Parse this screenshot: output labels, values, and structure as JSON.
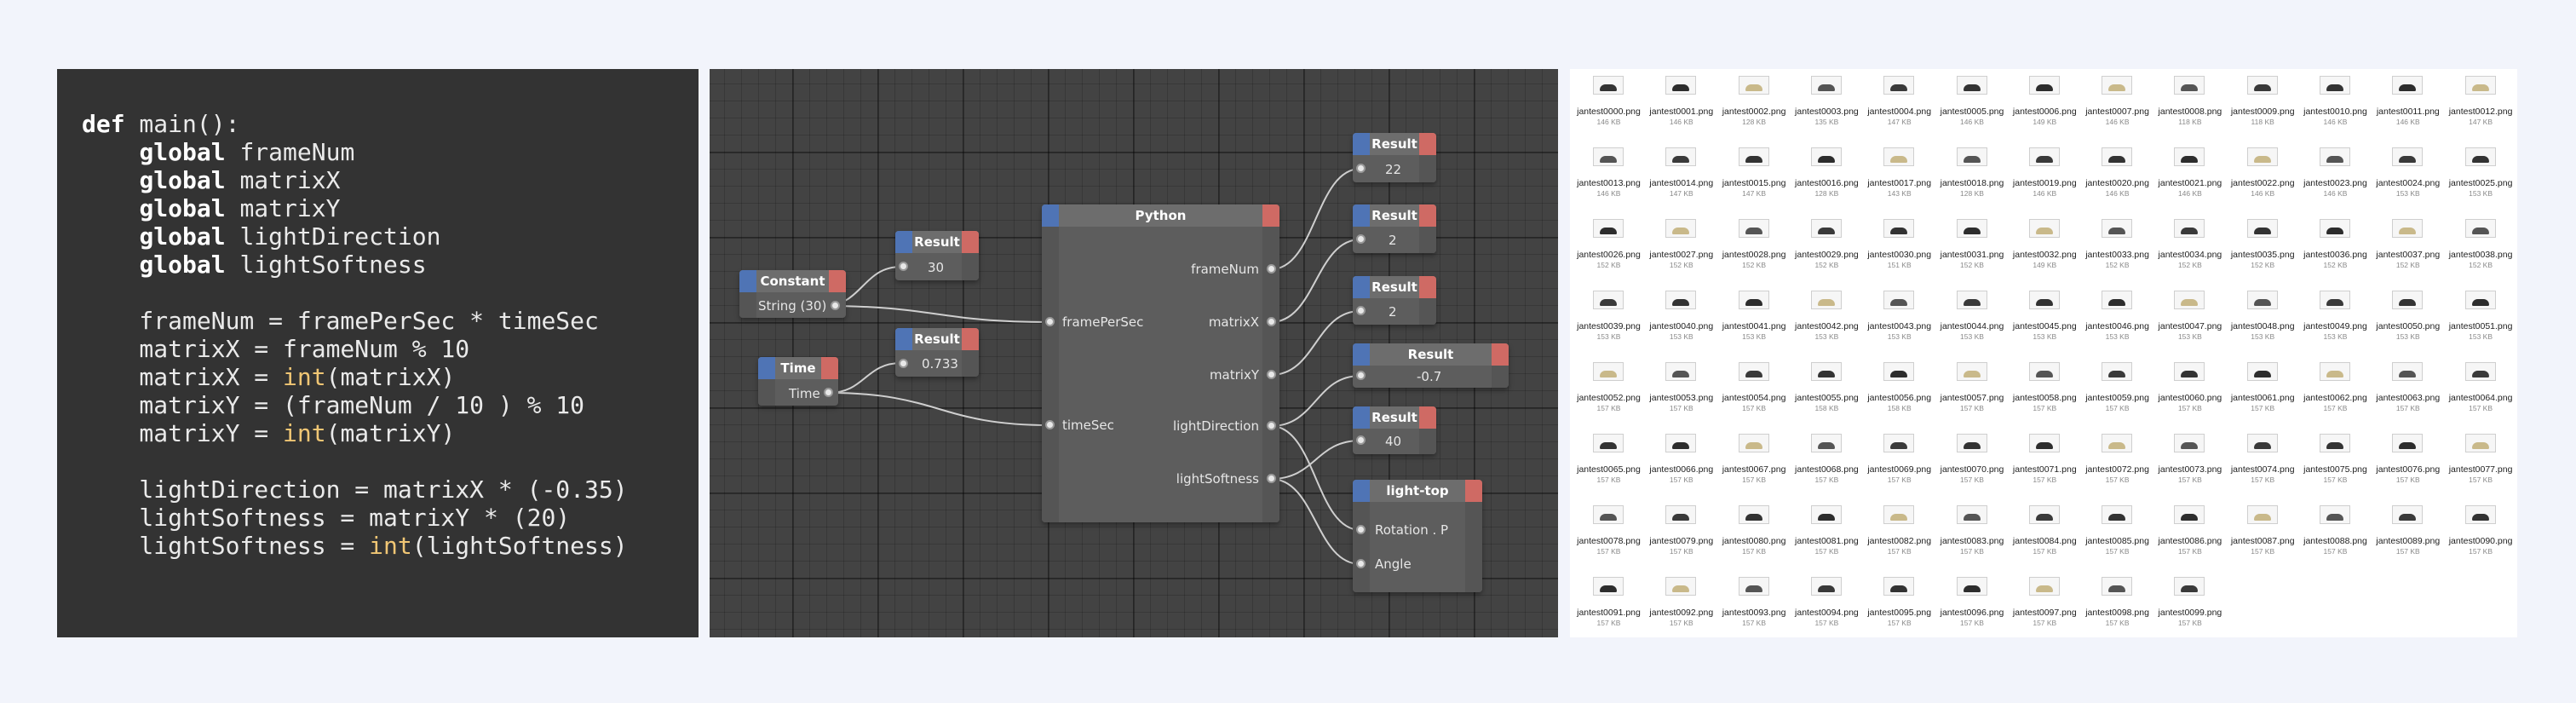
{
  "code": {
    "lines": [
      [
        {
          "t": "def",
          "c": "kw"
        },
        {
          "t": " main():",
          "c": ""
        }
      ],
      [
        {
          "t": "    ",
          "c": ""
        },
        {
          "t": "global",
          "c": "kw"
        },
        {
          "t": " frameNum",
          "c": ""
        }
      ],
      [
        {
          "t": "    ",
          "c": ""
        },
        {
          "t": "global",
          "c": "kw"
        },
        {
          "t": " matrixX",
          "c": ""
        }
      ],
      [
        {
          "t": "    ",
          "c": ""
        },
        {
          "t": "global",
          "c": "kw"
        },
        {
          "t": " matrixY",
          "c": ""
        }
      ],
      [
        {
          "t": "    ",
          "c": ""
        },
        {
          "t": "global",
          "c": "kw"
        },
        {
          "t": " lightDirection",
          "c": ""
        }
      ],
      [
        {
          "t": "    ",
          "c": ""
        },
        {
          "t": "global",
          "c": "kw"
        },
        {
          "t": " lightSoftness",
          "c": ""
        }
      ],
      [],
      [
        {
          "t": "    frameNum = framePerSec * timeSec",
          "c": ""
        }
      ],
      [
        {
          "t": "    matrixX = frameNum % 10",
          "c": ""
        }
      ],
      [
        {
          "t": "    matrixX = ",
          "c": ""
        },
        {
          "t": "int",
          "c": "fn"
        },
        {
          "t": "(matrixX)",
          "c": ""
        }
      ],
      [
        {
          "t": "    matrixY = (frameNum / 10 ) % 10",
          "c": ""
        }
      ],
      [
        {
          "t": "    matrixY = ",
          "c": ""
        },
        {
          "t": "int",
          "c": "fn"
        },
        {
          "t": "(matrixY)",
          "c": ""
        }
      ],
      [],
      [
        {
          "t": "    lightDirection = matrixX * (-0.35)",
          "c": ""
        }
      ],
      [
        {
          "t": "    lightSoftness = matrixY * (20)",
          "c": ""
        }
      ],
      [
        {
          "t": "    lightSoftness = ",
          "c": ""
        },
        {
          "t": "int",
          "c": "fn"
        },
        {
          "t": "(lightSoftness)",
          "c": ""
        }
      ]
    ]
  },
  "nodes": {
    "constant": {
      "title": "Constant",
      "value": "String (30)"
    },
    "time": {
      "title": "Time",
      "value": "Time"
    },
    "result_30": {
      "title": "Result",
      "value": "30"
    },
    "result_0733": {
      "title": "Result",
      "value": "0.733"
    },
    "python": {
      "title": "Python",
      "inputs": [
        "framePerSec",
        "timeSec"
      ],
      "outputs": [
        "frameNum",
        "matrixX",
        "matrixY",
        "lightDirection",
        "lightSoftness"
      ]
    },
    "result_22": {
      "title": "Result",
      "value": "22"
    },
    "result_2a": {
      "title": "Result",
      "value": "2"
    },
    "result_2b": {
      "title": "Result",
      "value": "2"
    },
    "result_neg07": {
      "title": "Result",
      "value": "-0.7"
    },
    "result_40": {
      "title": "Result",
      "value": "40"
    },
    "light_top": {
      "title": "light-top",
      "inputs": [
        "Rotation . P",
        "Angle"
      ]
    }
  },
  "files": {
    "items": [
      {
        "name": "jantest0000.png",
        "size": "146 KB"
      },
      {
        "name": "jantest0001.png",
        "size": "146 KB"
      },
      {
        "name": "jantest0002.png",
        "size": "128 KB"
      },
      {
        "name": "jantest0003.png",
        "size": "135 KB"
      },
      {
        "name": "jantest0004.png",
        "size": "147 KB"
      },
      {
        "name": "jantest0005.png",
        "size": "146 KB"
      },
      {
        "name": "jantest0006.png",
        "size": "149 KB"
      },
      {
        "name": "jantest0007.png",
        "size": "146 KB"
      },
      {
        "name": "jantest0008.png",
        "size": "118 KB"
      },
      {
        "name": "jantest0009.png",
        "size": "118 KB"
      },
      {
        "name": "jantest0010.png",
        "size": "146 KB"
      },
      {
        "name": "jantest0011.png",
        "size": "146 KB"
      },
      {
        "name": "jantest0012.png",
        "size": "147 KB"
      },
      {
        "name": "jantest0013.png",
        "size": "146 KB"
      },
      {
        "name": "jantest0014.png",
        "size": "147 KB"
      },
      {
        "name": "jantest0015.png",
        "size": "147 KB"
      },
      {
        "name": "jantest0016.png",
        "size": "128 KB"
      },
      {
        "name": "jantest0017.png",
        "size": "143 KB"
      },
      {
        "name": "jantest0018.png",
        "size": "128 KB"
      },
      {
        "name": "jantest0019.png",
        "size": "146 KB"
      },
      {
        "name": "jantest0020.png",
        "size": "146 KB"
      },
      {
        "name": "jantest0021.png",
        "size": "146 KB"
      },
      {
        "name": "jantest0022.png",
        "size": "146 KB"
      },
      {
        "name": "jantest0023.png",
        "size": "146 KB"
      },
      {
        "name": "jantest0024.png",
        "size": "153 KB"
      },
      {
        "name": "jantest0025.png",
        "size": "153 KB"
      },
      {
        "name": "jantest0026.png",
        "size": "152 KB"
      },
      {
        "name": "jantest0027.png",
        "size": "152 KB"
      },
      {
        "name": "jantest0028.png",
        "size": "152 KB"
      },
      {
        "name": "jantest0029.png",
        "size": "152 KB"
      },
      {
        "name": "jantest0030.png",
        "size": "151 KB"
      },
      {
        "name": "jantest0031.png",
        "size": "152 KB"
      },
      {
        "name": "jantest0032.png",
        "size": "149 KB"
      },
      {
        "name": "jantest0033.png",
        "size": "152 KB"
      },
      {
        "name": "jantest0034.png",
        "size": "152 KB"
      },
      {
        "name": "jantest0035.png",
        "size": "152 KB"
      },
      {
        "name": "jantest0036.png",
        "size": "152 KB"
      },
      {
        "name": "jantest0037.png",
        "size": "152 KB"
      },
      {
        "name": "jantest0038.png",
        "size": "152 KB"
      },
      {
        "name": "jantest0039.png",
        "size": "153 KB"
      },
      {
        "name": "jantest0040.png",
        "size": "153 KB"
      },
      {
        "name": "jantest0041.png",
        "size": "153 KB"
      },
      {
        "name": "jantest0042.png",
        "size": "153 KB"
      },
      {
        "name": "jantest0043.png",
        "size": "153 KB"
      },
      {
        "name": "jantest0044.png",
        "size": "153 KB"
      },
      {
        "name": "jantest0045.png",
        "size": "153 KB"
      },
      {
        "name": "jantest0046.png",
        "size": "153 KB"
      },
      {
        "name": "jantest0047.png",
        "size": "153 KB"
      },
      {
        "name": "jantest0048.png",
        "size": "153 KB"
      },
      {
        "name": "jantest0049.png",
        "size": "153 KB"
      },
      {
        "name": "jantest0050.png",
        "size": "153 KB"
      },
      {
        "name": "jantest0051.png",
        "size": "153 KB"
      },
      {
        "name": "jantest0052.png",
        "size": "157 KB"
      },
      {
        "name": "jantest0053.png",
        "size": "157 KB"
      },
      {
        "name": "jantest0054.png",
        "size": "157 KB"
      },
      {
        "name": "jantest0055.png",
        "size": "158 KB"
      },
      {
        "name": "jantest0056.png",
        "size": "158 KB"
      },
      {
        "name": "jantest0057.png",
        "size": "157 KB"
      },
      {
        "name": "jantest0058.png",
        "size": "157 KB"
      },
      {
        "name": "jantest0059.png",
        "size": "157 KB"
      },
      {
        "name": "jantest0060.png",
        "size": "157 KB"
      },
      {
        "name": "jantest0061.png",
        "size": "157 KB"
      },
      {
        "name": "jantest0062.png",
        "size": "157 KB"
      },
      {
        "name": "jantest0063.png",
        "size": "157 KB"
      },
      {
        "name": "jantest0064.png",
        "size": "157 KB"
      },
      {
        "name": "jantest0065.png",
        "size": "157 KB"
      },
      {
        "name": "jantest0066.png",
        "size": "157 KB"
      },
      {
        "name": "jantest0067.png",
        "size": "157 KB"
      },
      {
        "name": "jantest0068.png",
        "size": "157 KB"
      },
      {
        "name": "jantest0069.png",
        "size": "157 KB"
      },
      {
        "name": "jantest0070.png",
        "size": "157 KB"
      },
      {
        "name": "jantest0071.png",
        "size": "157 KB"
      },
      {
        "name": "jantest0072.png",
        "size": "157 KB"
      },
      {
        "name": "jantest0073.png",
        "size": "157 KB"
      },
      {
        "name": "jantest0074.png",
        "size": "157 KB"
      },
      {
        "name": "jantest0075.png",
        "size": "157 KB"
      },
      {
        "name": "jantest0076.png",
        "size": "157 KB"
      },
      {
        "name": "jantest0077.png",
        "size": "157 KB"
      },
      {
        "name": "jantest0078.png",
        "size": "157 KB"
      },
      {
        "name": "jantest0079.png",
        "size": "157 KB"
      },
      {
        "name": "jantest0080.png",
        "size": "157 KB"
      },
      {
        "name": "jantest0081.png",
        "size": "157 KB"
      },
      {
        "name": "jantest0082.png",
        "size": "157 KB"
      },
      {
        "name": "jantest0083.png",
        "size": "157 KB"
      },
      {
        "name": "jantest0084.png",
        "size": "157 KB"
      },
      {
        "name": "jantest0085.png",
        "size": "157 KB"
      },
      {
        "name": "jantest0086.png",
        "size": "157 KB"
      },
      {
        "name": "jantest0087.png",
        "size": "157 KB"
      },
      {
        "name": "jantest0088.png",
        "size": "157 KB"
      },
      {
        "name": "jantest0089.png",
        "size": "157 KB"
      },
      {
        "name": "jantest0090.png",
        "size": "157 KB"
      },
      {
        "name": "jantest0091.png",
        "size": "157 KB"
      },
      {
        "name": "jantest0092.png",
        "size": "157 KB"
      },
      {
        "name": "jantest0093.png",
        "size": "157 KB"
      },
      {
        "name": "jantest0094.png",
        "size": "157 KB"
      },
      {
        "name": "jantest0095.png",
        "size": "157 KB"
      },
      {
        "name": "jantest0096.png",
        "size": "157 KB"
      },
      {
        "name": "jantest0097.png",
        "size": "157 KB"
      },
      {
        "name": "jantest0098.png",
        "size": "157 KB"
      },
      {
        "name": "jantest0099.png",
        "size": "157 KB"
      }
    ]
  },
  "colors": {
    "accent_blue": "#4f74b5",
    "accent_red": "#cf6a64",
    "code_function": "#f0c674",
    "node_editor_bg": "#434343",
    "code_bg": "#333333"
  }
}
